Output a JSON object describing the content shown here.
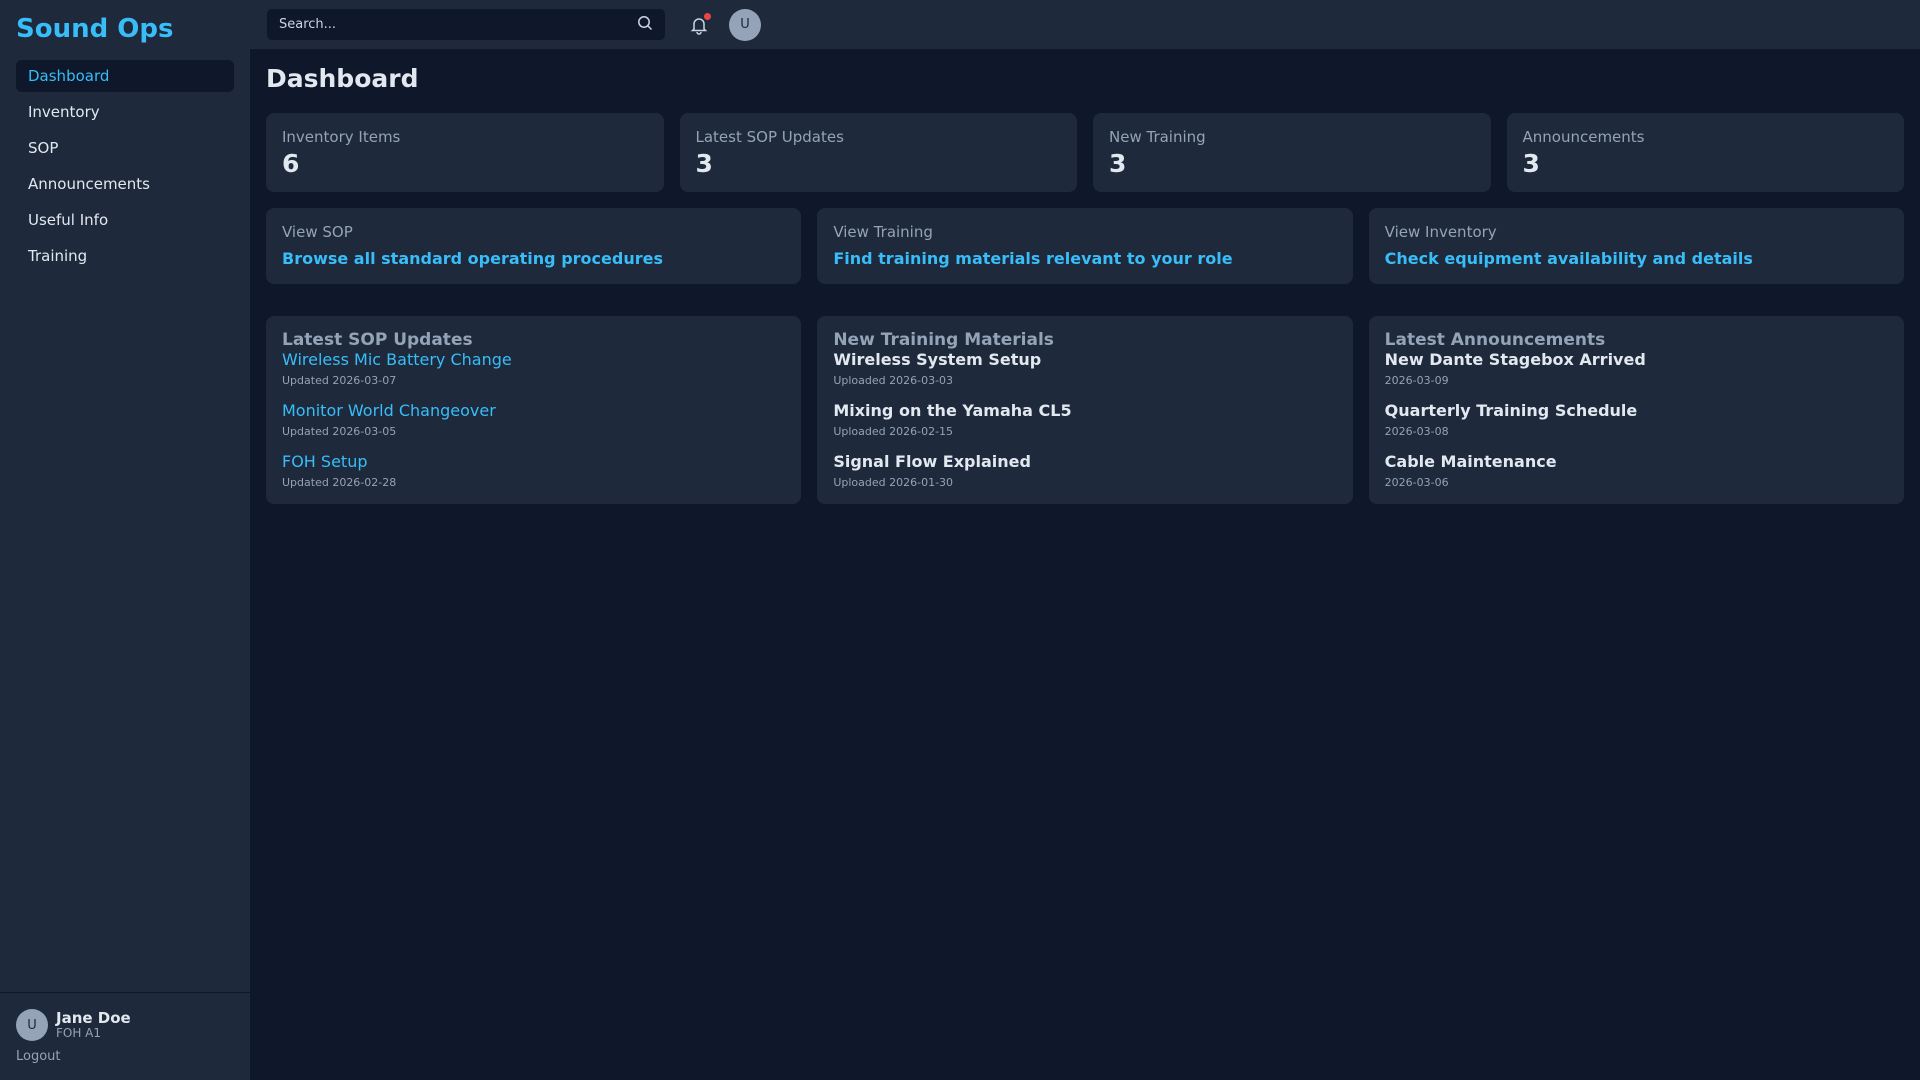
{
  "sidebar": {
    "brand": "Sound Ops",
    "items": [
      {
        "label": "Dashboard"
      },
      {
        "label": "Inventory"
      },
      {
        "label": "SOP"
      },
      {
        "label": "Announcements"
      },
      {
        "label": "Useful Info"
      },
      {
        "label": "Training"
      }
    ],
    "user": {
      "initial": "U",
      "name": "Jane Doe",
      "role": "FOH A1",
      "logout": "Logout"
    }
  },
  "topbar": {
    "search_placeholder": "Search...",
    "avatar_initial": "U",
    "notification_color": "#ef4444"
  },
  "main": {
    "title": "Dashboard",
    "stats": [
      {
        "label": "Inventory Items",
        "value": "6"
      },
      {
        "label": "Latest SOP Updates",
        "value": "3"
      },
      {
        "label": "New Training",
        "value": "3"
      },
      {
        "label": "Announcements",
        "value": "3"
      }
    ],
    "quick": [
      {
        "label": "View SOP",
        "link": "Browse all standard operating procedures"
      },
      {
        "label": "View Training",
        "link": "Find training materials relevant to your role"
      },
      {
        "label": "View Inventory",
        "link": "Check equipment availability and details"
      }
    ],
    "sop": {
      "title": "Latest SOP Updates",
      "items": [
        {
          "title": "Wireless Mic Battery Change",
          "date": "Updated 2026-03-07"
        },
        {
          "title": "Monitor World Changeover",
          "date": "Updated 2026-03-05"
        },
        {
          "title": "FOH Setup",
          "date": "Updated 2026-02-28"
        }
      ]
    },
    "training": {
      "title": "New Training Materials",
      "items": [
        {
          "title": "Wireless System Setup",
          "date": "Uploaded 2026-03-03"
        },
        {
          "title": "Mixing on the Yamaha CL5",
          "date": "Uploaded 2026-02-15"
        },
        {
          "title": "Signal Flow Explained",
          "date": "Uploaded 2026-01-30"
        }
      ]
    },
    "announcements": {
      "title": "Latest Announcements",
      "items": [
        {
          "title": "New Dante Stagebox Arrived",
          "date": "2026-03-09"
        },
        {
          "title": "Quarterly Training Schedule",
          "date": "2026-03-08"
        },
        {
          "title": "Cable Maintenance",
          "date": "2026-03-06"
        }
      ]
    }
  },
  "colors": {
    "accent": "#38bdf8",
    "background": "#0f172a",
    "surface": "#1e293b"
  }
}
